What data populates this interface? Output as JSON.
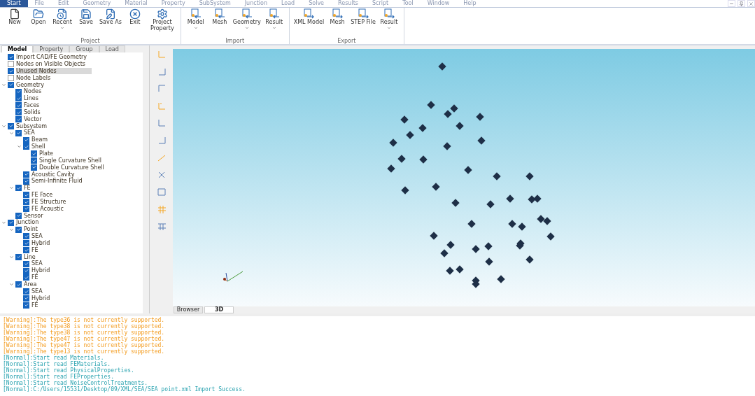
{
  "menu": [
    {
      "label": "Start",
      "selected": true
    },
    {
      "label": "File",
      "selected": false
    },
    {
      "label": "Edit",
      "selected": false
    },
    {
      "label": "Geometry",
      "selected": false
    },
    {
      "label": "Material",
      "selected": false
    },
    {
      "label": "Property",
      "selected": false
    },
    {
      "label": "SubSystem",
      "selected": false
    },
    {
      "label": "Junction",
      "selected": false
    },
    {
      "label": "Load",
      "selected": false
    },
    {
      "label": "Solve",
      "selected": false
    },
    {
      "label": "Results",
      "selected": false
    },
    {
      "label": "Script",
      "selected": false
    },
    {
      "label": "Tool",
      "selected": false
    },
    {
      "label": "Window",
      "selected": false
    },
    {
      "label": "Help",
      "selected": false
    }
  ],
  "ribbon": [
    {
      "title": "Project",
      "buttons": [
        {
          "kind": "new",
          "label": "New"
        },
        {
          "kind": "open",
          "label": "Open"
        },
        {
          "kind": "recent",
          "label": "Recent",
          "dropdown": true
        },
        {
          "kind": "save",
          "label": "Save"
        },
        {
          "kind": "saveas",
          "label": "Save As"
        },
        {
          "kind": "exit",
          "label": "Exit"
        },
        {
          "kind": "gear",
          "label": "Project Property"
        }
      ]
    },
    {
      "title": "Import",
      "buttons": [
        {
          "kind": "import",
          "label": "Model",
          "dropdown": true
        },
        {
          "kind": "import",
          "label": "Mesh"
        },
        {
          "kind": "import",
          "label": "Geometry",
          "dropdown": true
        },
        {
          "kind": "import",
          "label": "Result",
          "dropdown": true
        }
      ]
    },
    {
      "title": "Export",
      "buttons": [
        {
          "kind": "export",
          "label": "XML Model"
        },
        {
          "kind": "export",
          "label": "Mesh"
        },
        {
          "kind": "export",
          "label": "STEP File"
        },
        {
          "kind": "export",
          "label": "Result",
          "dropdown": true
        }
      ]
    }
  ],
  "panel_tabs": [
    {
      "label": "Model",
      "selected": true
    },
    {
      "label": "Property",
      "selected": false
    },
    {
      "label": "Group",
      "selected": false
    },
    {
      "label": "Load",
      "selected": false
    }
  ],
  "tree": [
    {
      "label": "Import CAD/FE Geometry",
      "checked": true,
      "selected": false
    },
    {
      "label": "Nodes on Visible Objects",
      "checked": false,
      "selected": false
    },
    {
      "label": "Unused Nodes",
      "checked": true,
      "selected": true
    },
    {
      "label": "Node Labels",
      "checked": false,
      "selected": false
    },
    {
      "label": "Geometry",
      "checked": true,
      "selected": false,
      "expanded": true,
      "children": [
        {
          "label": "Nodes",
          "checked": true,
          "selected": false
        },
        {
          "label": "Lines",
          "checked": true,
          "selected": false
        },
        {
          "label": "Faces",
          "checked": true,
          "selected": false
        },
        {
          "label": "Solids",
          "checked": true,
          "selected": false
        },
        {
          "label": "Vector",
          "checked": true,
          "selected": false
        }
      ]
    },
    {
      "label": "Subsystem",
      "checked": true,
      "selected": false,
      "expanded": true,
      "children": [
        {
          "label": "SEA",
          "checked": true,
          "selected": false,
          "expanded": true,
          "children": [
            {
              "label": "Beam",
              "checked": true,
              "selected": false
            },
            {
              "label": "Shell",
              "checked": true,
              "selected": false,
              "expanded": true,
              "children": [
                {
                  "label": "Plate",
                  "checked": true,
                  "selected": false
                },
                {
                  "label": "Single Curvature Shell",
                  "checked": true,
                  "selected": false
                },
                {
                  "label": "Double Curvature Shell",
                  "checked": true,
                  "selected": false
                }
              ]
            },
            {
              "label": "Acoustic Cavity",
              "checked": true,
              "selected": false
            },
            {
              "label": "Semi-Infinite Fluid",
              "checked": true,
              "selected": false
            }
          ]
        },
        {
          "label": "FE",
          "checked": true,
          "selected": false,
          "expanded": true,
          "children": [
            {
              "label": "FE Face",
              "checked": true,
              "selected": false
            },
            {
              "label": "FE Structure",
              "checked": true,
              "selected": false
            },
            {
              "label": "FE Acoustic",
              "checked": true,
              "selected": false
            }
          ]
        },
        {
          "label": "Sensor",
          "checked": true,
          "selected": false
        }
      ]
    },
    {
      "label": "Junction",
      "checked": true,
      "selected": false,
      "expanded": true,
      "children": [
        {
          "label": "Point",
          "checked": true,
          "selected": false,
          "expanded": true,
          "children": [
            {
              "label": "SEA",
              "checked": true,
              "selected": false
            },
            {
              "label": "Hybrid",
              "checked": true,
              "selected": false
            },
            {
              "label": "FE",
              "checked": true,
              "selected": false
            }
          ]
        },
        {
          "label": "Line",
          "checked": true,
          "selected": false,
          "expanded": true,
          "children": [
            {
              "label": "SEA",
              "checked": true,
              "selected": false
            },
            {
              "label": "Hybrid",
              "checked": true,
              "selected": false
            },
            {
              "label": "FE",
              "checked": true,
              "selected": false
            }
          ]
        },
        {
          "label": "Area",
          "checked": true,
          "selected": false,
          "expanded": true,
          "children": [
            {
              "label": "SEA",
              "checked": true,
              "selected": false
            },
            {
              "label": "Hybrid",
              "checked": true,
              "selected": false
            },
            {
              "label": "FE",
              "checked": true,
              "selected": false
            }
          ]
        }
      ]
    }
  ],
  "view_tabs": [
    {
      "label": "Browser",
      "selected": false
    },
    {
      "label": "3D",
      "selected": true
    }
  ],
  "log": [
    {
      "kind": "warning",
      "text": "[Warning]:The type36 is not currently supported."
    },
    {
      "kind": "warning",
      "text": "[Warning]:The type38 is not currently supported."
    },
    {
      "kind": "warning",
      "text": "[Warning]:The type38 is not currently supported."
    },
    {
      "kind": "warning",
      "text": "[Warning]:The type47 is not currently supported."
    },
    {
      "kind": "warning",
      "text": "[Warning]:The type47 is not currently supported."
    },
    {
      "kind": "warning",
      "text": "[Warning]:The type13 is not currently supported."
    },
    {
      "kind": "normal",
      "text": "[Normal]:Start read Materials."
    },
    {
      "kind": "normal",
      "text": "[Normal]:Start read FEMaterials."
    },
    {
      "kind": "normal",
      "text": "[Normal]:Start read PhysicalProperties."
    },
    {
      "kind": "normal",
      "text": "[Normal]:Start read FEProperties."
    },
    {
      "kind": "normal",
      "text": "[Normal]:Start read NoiseControlTreatments."
    },
    {
      "kind": "normal",
      "text": "[Normal]:C:/Users/15531/Desktop/09/XML/SEA/SEA point.xml Import Success."
    }
  ]
}
